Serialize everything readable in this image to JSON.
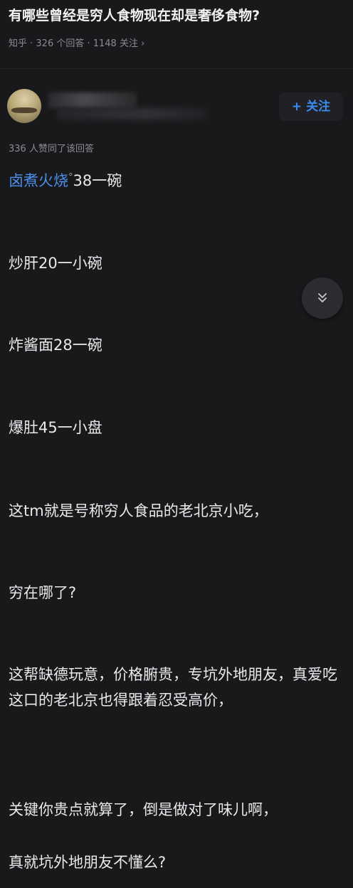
{
  "question": {
    "title": "有哪些曾经是穷人食物现在却是奢侈食物?",
    "meta": "知乎 · 326 个回答 · 1148 关注 ›"
  },
  "author": {
    "follow_label": "+ 关注"
  },
  "answer": {
    "likes": "336 人赞同了该回答",
    "first_line": {
      "link_text": "卤煮火烧",
      "rest": "38一碗"
    },
    "paragraphs": [
      "炒肝20一小碗",
      "炸酱面28一碗",
      "爆肚45一小盘",
      "这tm就是号称穷人食品的老北京小吃，",
      "穷在哪了?",
      "这帮缺德玩意，价格腑贵，专坑外地朋友，真爱吃这口的老北京也得跟着忍受高价，",
      "关键你贵点就算了，倒是做对了味儿啊，",
      "真就坑外地朋友不懂么?"
    ]
  },
  "colors": {
    "background": "#19191b",
    "link": "#4a8fe8",
    "follow": "#3c8cf0"
  },
  "icons": {
    "collapse": "double-chevron-down-icon",
    "link_mark": "search-link-icon"
  }
}
